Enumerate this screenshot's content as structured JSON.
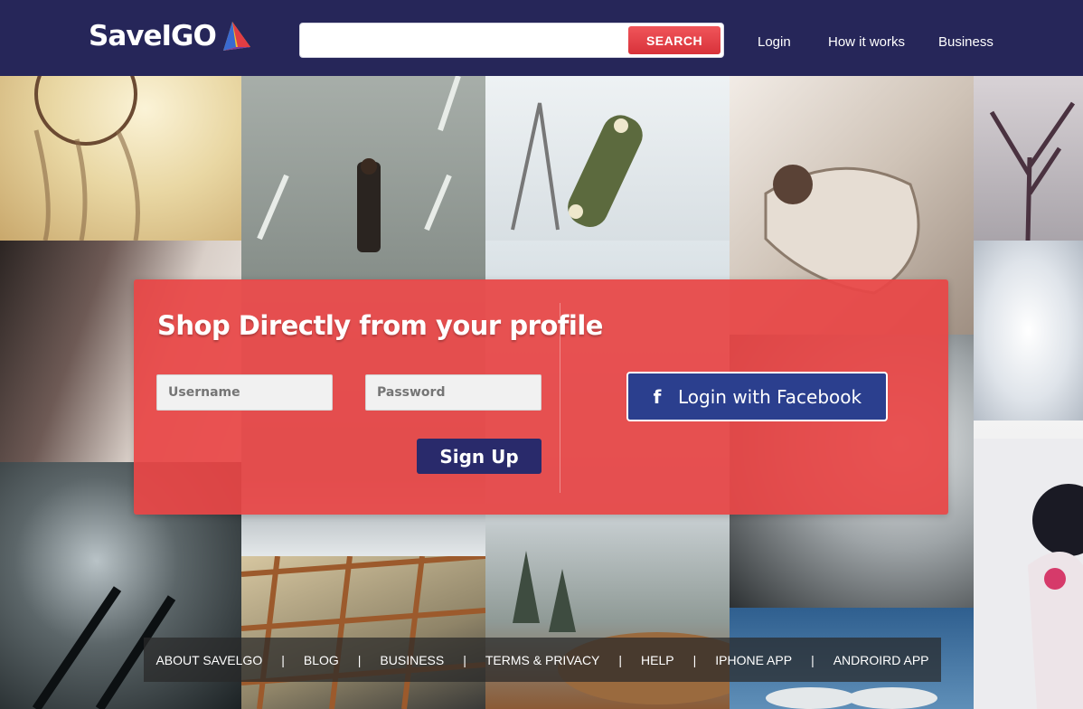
{
  "header": {
    "logo_text": "SaveIGO",
    "search": {
      "value": "",
      "placeholder": "",
      "button_label": "SEARCH"
    },
    "nav": [
      "Login",
      "How it works",
      "Business"
    ]
  },
  "signup_panel": {
    "headline": "Shop Directly from your profile",
    "username_placeholder": "Username",
    "password_placeholder": "Password",
    "signup_label": "Sign Up",
    "facebook_label": "Login with Facebook",
    "facebook_icon": "f"
  },
  "footer": {
    "links": [
      "ABOUT SAVELGO",
      "BLOG",
      "BUSINESS",
      "TERMS & PRIVACY",
      "HELP",
      "IPHONE APP",
      "ANDROIRD APP"
    ],
    "separator": "|"
  },
  "colors": {
    "header_bg": "#262659",
    "panel_red": "#e84646",
    "search_button": "#e23d43",
    "signup_button": "#292a6b",
    "facebook_button": "#2b3f8e"
  }
}
